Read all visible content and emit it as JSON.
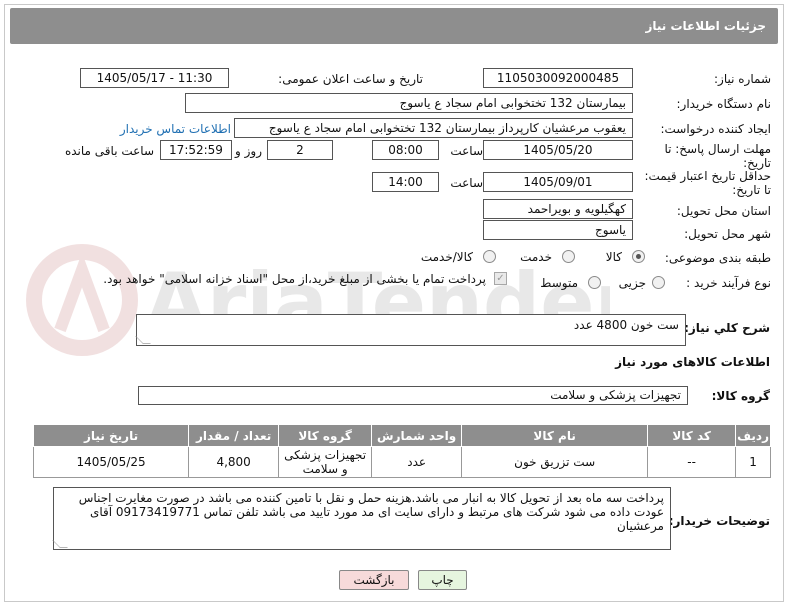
{
  "header": {
    "title": "جزئیات اطلاعات نیاز"
  },
  "watermark": {
    "text": "AriaTender.net"
  },
  "form": {
    "need_number_label": "شماره نیاز:",
    "need_number": "1105030092000485",
    "announce_label": "تاریخ و ساعت اعلان عمومی:",
    "announce_value": "1405/05/17 - 11:30",
    "buyer_org_label": "نام دستگاه خریدار:",
    "buyer_org": "بیمارستان 132 تختخوابی امام سجاد  ع  یاسوج",
    "creator_label": "ایجاد کننده درخواست:",
    "creator": "یعقوب مرعشیان کارپرداز بیمارستان 132 تختخوابی امام سجاد  ع  یاسوج",
    "buyer_contact_link": "اطلاعات تماس خریدار",
    "deadline_label_1": "مهلت ارسال پاسخ: تا",
    "deadline_label_2": "تاریخ:",
    "deadline_date": "1405/05/20",
    "time_label": "ساعت",
    "deadline_time": "08:00",
    "days_value": "2",
    "days_label": "روز و",
    "remaining_time": "17:52:59",
    "remaining_label": "ساعت باقی مانده",
    "price_validity_label_1": "حداقل تاریخ اعتبار قیمت:",
    "price_validity_label_2": "تا تاریخ:",
    "price_validity_date": "1405/09/01",
    "price_validity_time": "14:00",
    "province_label": "استان محل تحویل:",
    "province": "کهگیلویه و بویراحمد",
    "city_label": "شهر محل تحویل:",
    "city": "یاسوج",
    "category_label": "طبقه بندی موضوعی:",
    "category_options": [
      "کالا",
      "خدمت",
      "کالا/خدمت"
    ],
    "process_label": "نوع فرآیند خرید :",
    "process_options": [
      "جزیی",
      "متوسط"
    ],
    "payment_note": "پرداخت تمام یا بخشی از مبلغ خرید،از محل \"اسناد خزانه اسلامی\" خواهد بود."
  },
  "description": {
    "label": "شرح كلي نياز:",
    "value": "ست خون 4800 عدد"
  },
  "goods": {
    "section_title": "اطلاعات کالاهای مورد نیاز",
    "group_label": "گروه کالا:",
    "group_value": "تجهیزات پزشکی و سلامت",
    "columns": [
      "ردیف",
      "کد کالا",
      "نام کالا",
      "واحد شمارش",
      "گروه کالا",
      "تعداد / مقدار",
      "تاریخ نیاز"
    ],
    "rows": [
      [
        "1",
        "--",
        "ست تزریق خون",
        "عدد",
        "تجهیزات پزشکی و سلامت",
        "4,800",
        "1405/05/25"
      ]
    ]
  },
  "buyer_notes": {
    "label": "توضیحات خریدار:",
    "value": "پرداخت سه ماه بعد از تحویل کالا به انبار می باشد.هزینه حمل و نقل با تامین کننده می باشد در صورت مغایرت اجناس عودت داده می شود شرکت های مرتبط و دارای سایت ای مد مورد تایید می باشد تلفن تماس 09173419771 آقای مرعشیان"
  },
  "buttons": {
    "print": "چاپ",
    "back": "بازگشت"
  },
  "colors": {
    "header_bg": "#8e8e8e",
    "link": "#1f6fb2",
    "back_bg": "#f7dada",
    "print_bg": "#e6f5df"
  }
}
